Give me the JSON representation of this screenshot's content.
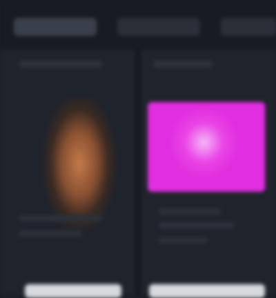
{
  "tabs": [
    {
      "label": "",
      "active": true
    },
    {
      "label": "",
      "active": false
    },
    {
      "label": "",
      "active": false
    }
  ],
  "panels": {
    "left": {
      "title": "",
      "lines": [
        "",
        ""
      ],
      "button_label": ""
    },
    "right": {
      "title": "",
      "lines": [
        "",
        "",
        ""
      ],
      "button_label": ""
    }
  },
  "colors": {
    "background": "#1b1e25",
    "panel": "#1f232b",
    "accent_magenta": "#e12ee0",
    "portrait_tone": "#c47a4a",
    "button": "#d6d9de"
  }
}
